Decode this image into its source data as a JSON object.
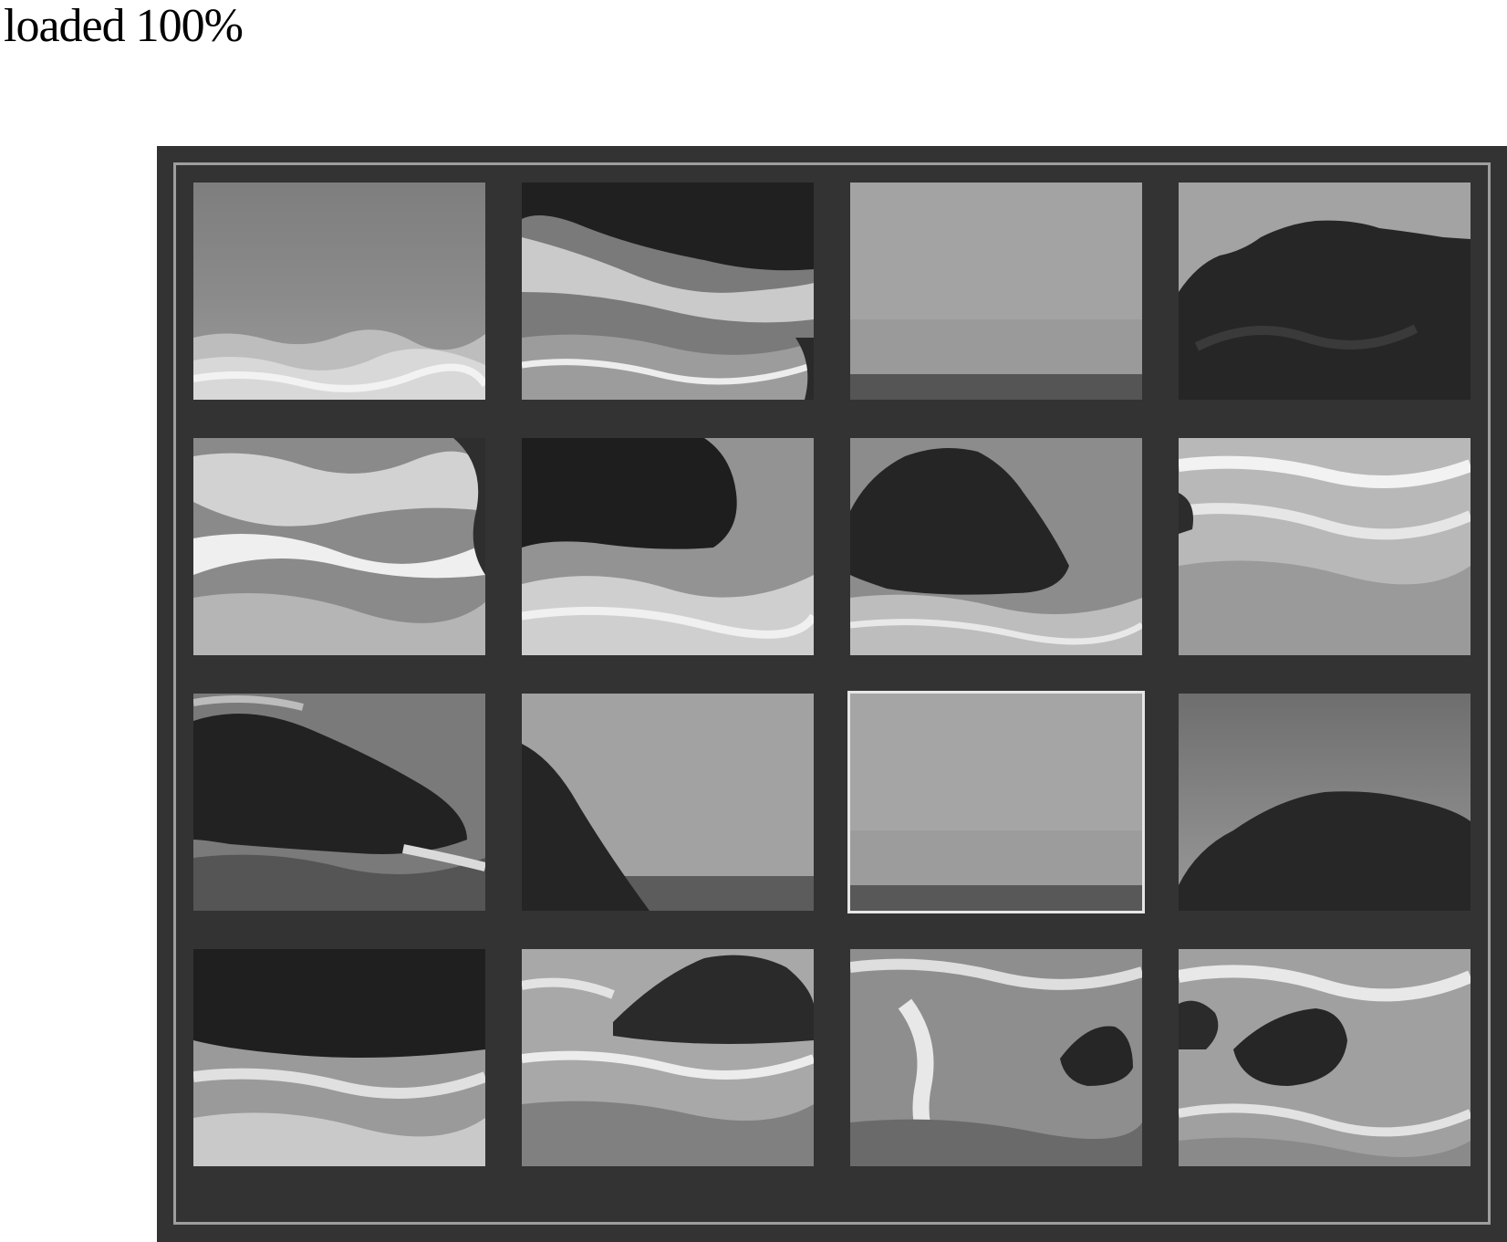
{
  "status": {
    "text": "loaded 100%"
  },
  "puzzle": {
    "grid": {
      "rows": 4,
      "cols": 4
    },
    "theme": "grayscale coastal seascape with dark rocks and surf",
    "colors": {
      "board": "#333333",
      "border": "#9e9e9e",
      "highlight": "#e6e6e6"
    },
    "tiles": [
      {
        "row": 0,
        "col": 0,
        "content": "sea-surf-horizon"
      },
      {
        "row": 0,
        "col": 1,
        "content": "rock-top-surf"
      },
      {
        "row": 0,
        "col": 2,
        "content": "sky-horizon"
      },
      {
        "row": 0,
        "col": 3,
        "content": "rock-right-mass"
      },
      {
        "row": 1,
        "col": 0,
        "content": "surf-foam"
      },
      {
        "row": 1,
        "col": 1,
        "content": "rock-left-water"
      },
      {
        "row": 1,
        "col": 2,
        "content": "rock-center-surf"
      },
      {
        "row": 1,
        "col": 3,
        "content": "surf-foam-light"
      },
      {
        "row": 2,
        "col": 0,
        "content": "rock-dark-surf"
      },
      {
        "row": 2,
        "col": 1,
        "content": "rock-slope-sky"
      },
      {
        "row": 2,
        "col": 2,
        "content": "sky-horizon",
        "selected": true
      },
      {
        "row": 2,
        "col": 3,
        "content": "rock-low-water"
      },
      {
        "row": 3,
        "col": 0,
        "content": "rock-bottom-surf"
      },
      {
        "row": 3,
        "col": 1,
        "content": "small-rock-surf"
      },
      {
        "row": 3,
        "col": 2,
        "content": "surf-rock-right"
      },
      {
        "row": 3,
        "col": 3,
        "content": "surf-rock-foam"
      }
    ]
  }
}
